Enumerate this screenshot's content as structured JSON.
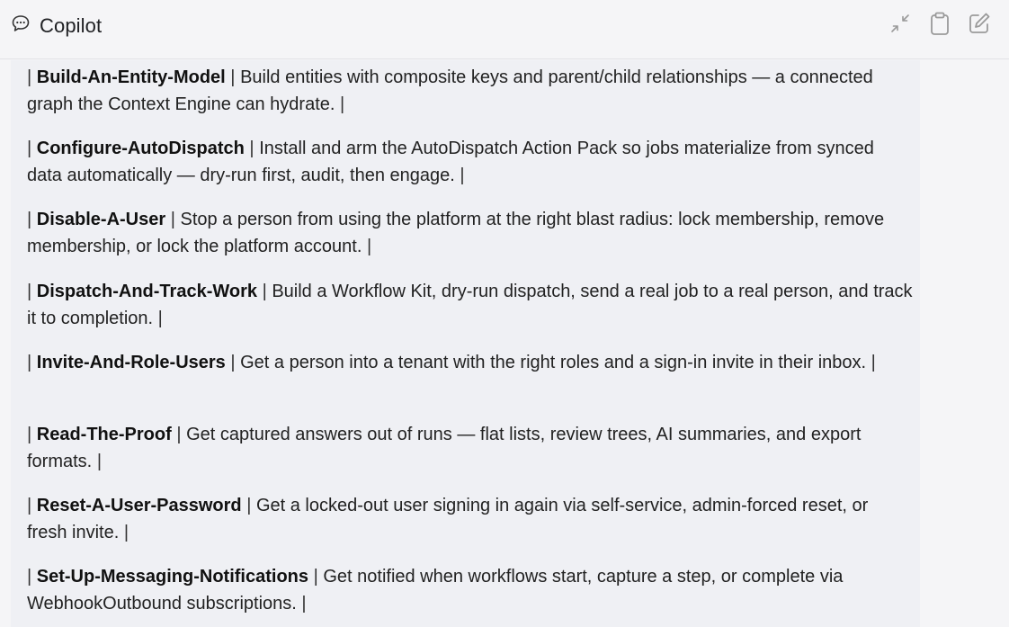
{
  "header": {
    "title": "Copilot",
    "icons": {
      "chat": "chat-bubble-icon",
      "minimize": "minimize-arrows-icon",
      "clipboard": "clipboard-icon",
      "edit": "edit-icon"
    }
  },
  "entries": [
    {
      "name": "Build-An-Entity-Model",
      "description": "Build entities with composite keys and parent/child relationships — a connected graph the Context Engine can hydrate."
    },
    {
      "name": "Configure-AutoDispatch",
      "description": "Install and arm the AutoDispatch Action Pack so jobs materialize from synced data automatically — dry-run first, audit, then engage."
    },
    {
      "name": "Disable-A-User",
      "description": "Stop a person from using the platform at the right blast radius: lock membership, remove membership, or lock the platform account."
    },
    {
      "name": "Dispatch-And-Track-Work",
      "description": "Build a Workflow Kit, dry-run dispatch, send a real job to a real person, and track it to completion."
    },
    {
      "name": "Invite-And-Role-Users",
      "description": "Get a person into a tenant with the right roles and a sign-in invite in their inbox."
    },
    {
      "name": "Read-The-Proof",
      "description": "Get captured answers out of runs — flat lists, review trees, AI summaries, and export formats."
    },
    {
      "name": "Reset-A-User-Password",
      "description": "Get a locked-out user signing in again via self-service, admin-forced reset, or fresh invite."
    },
    {
      "name": "Set-Up-Messaging-Notifications",
      "description": "Get notified when workflows start, capture a step, or complete via WebhookOutbound subscriptions."
    }
  ]
}
